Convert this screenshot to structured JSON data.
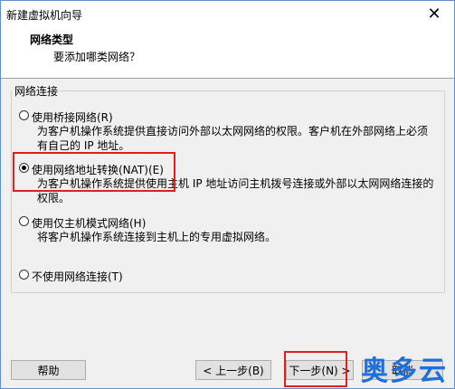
{
  "window": {
    "title": "新建虚拟机向导",
    "close_icon": "close-icon"
  },
  "header": {
    "title": "网络类型",
    "subtitle": "要添加哪类网络？"
  },
  "group": {
    "label": "网络连接"
  },
  "options": [
    {
      "label": "使用桥接网络(R)",
      "description": "为客户机操作系统提供直接访问外部以太网网络的权限。客户机在外部网络上必须有自己的 IP 地址。",
      "selected": false
    },
    {
      "label": "使用网络地址转换(NAT)(E)",
      "description": "为客户机操作系统提供使用主机 IP 地址访问主机拨号连接或外部以太网网络连接的权限。",
      "selected": true
    },
    {
      "label": "使用仅主机模式网络(H)",
      "description": "将客户机操作系统连接到主机上的专用虚拟网络。",
      "selected": false
    },
    {
      "label": "不使用网络连接(T)",
      "description": "",
      "selected": false
    }
  ],
  "buttons": {
    "help": "帮助",
    "back": "< 上一步(B)",
    "next": "下一步(N) >",
    "cancel": "取消"
  },
  "watermark": "奥多云",
  "colors": {
    "highlight": "#e02020",
    "watermark": "#1e6fd8"
  }
}
